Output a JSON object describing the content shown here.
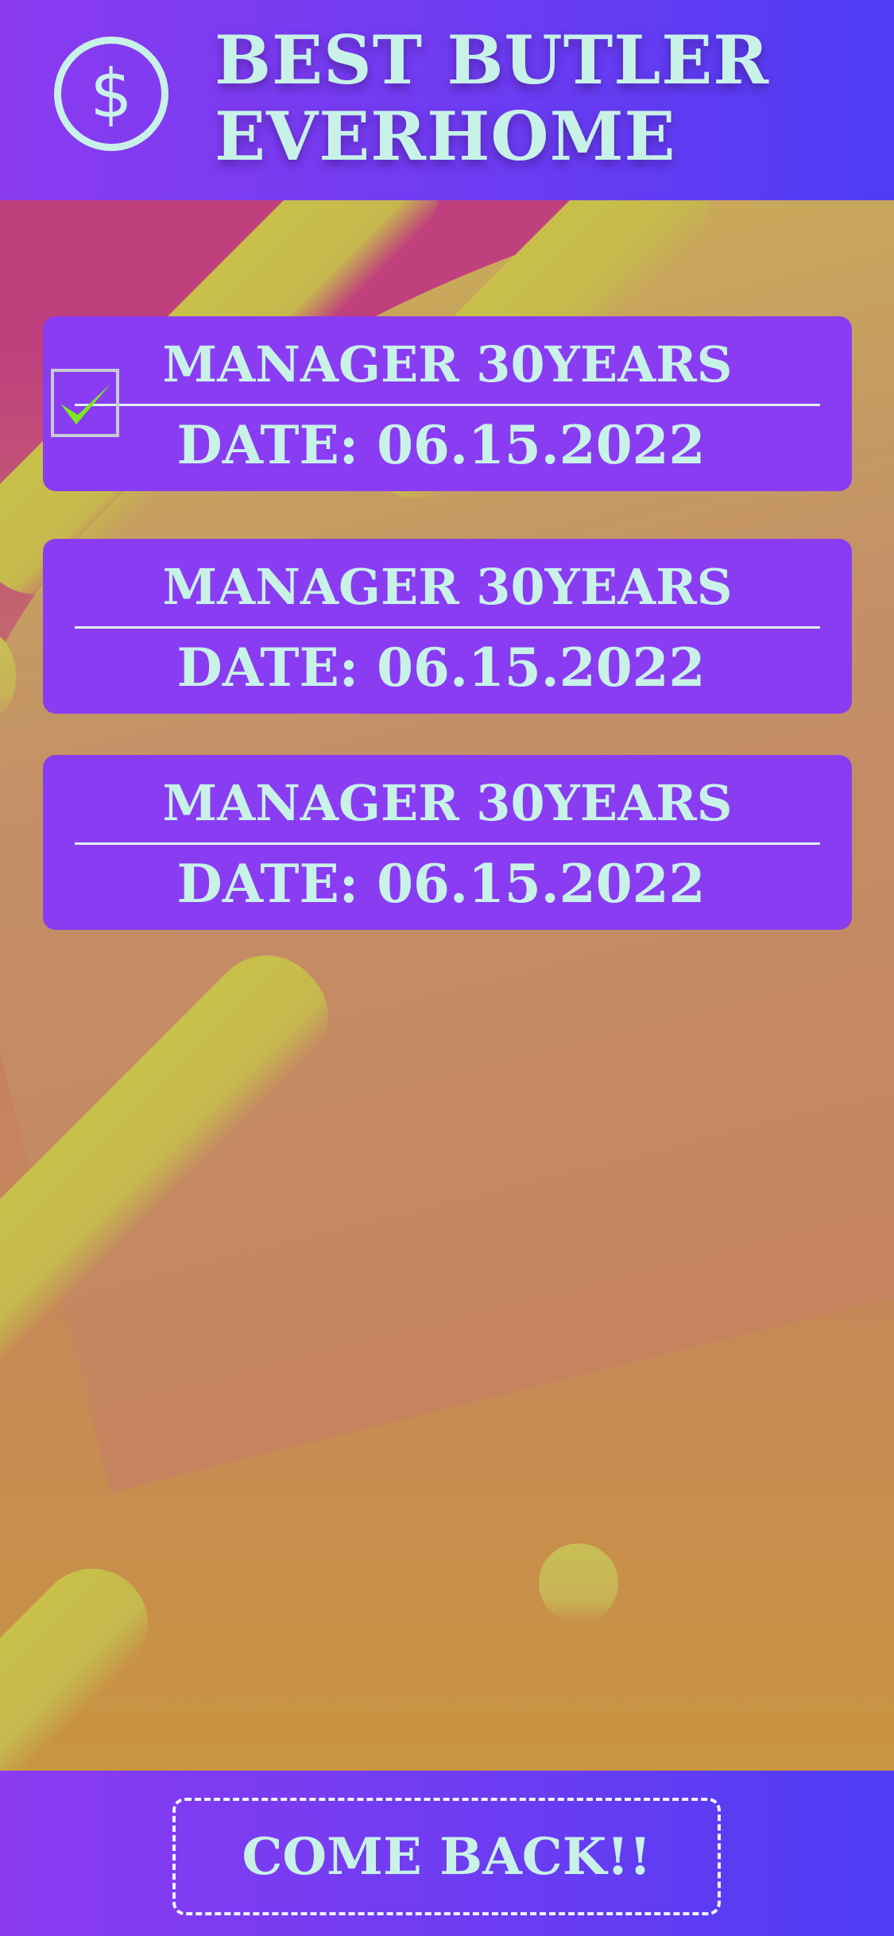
{
  "header": {
    "logo_symbol": "$",
    "title_line1": "BEST BUTLER",
    "title_line2": "EVERHOME"
  },
  "cards": [
    {
      "role": "MANAGER 30YEARS",
      "date": "DATE: 06.15.2022",
      "checked": true
    },
    {
      "role": "MANAGER 30YEARS",
      "date": "DATE: 06.15.2022",
      "checked": false
    },
    {
      "role": "MANAGER 30YEARS",
      "date": "DATE: 06.15.2022",
      "checked": false
    }
  ],
  "footer": {
    "back_label": "COME BACK!!"
  },
  "icons": {
    "logo": "dollar-circle-icon",
    "check": "checkmark-icon"
  },
  "colors": {
    "header_gradient_start": "#8b3bf0",
    "header_gradient_end": "#4f3cf4",
    "card_background": "#8a3cf2",
    "text": "#c8f2e8",
    "check": "#7bea1c"
  }
}
